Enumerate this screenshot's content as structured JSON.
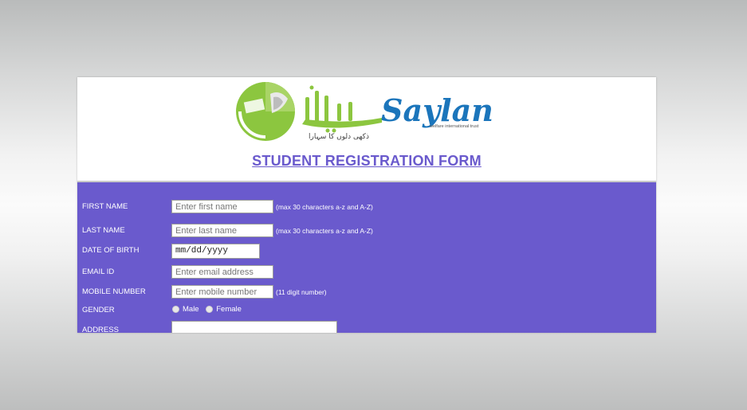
{
  "header": {
    "logo_text_urdu": "سیلانی",
    "logo_text_english": "Saylani",
    "logo_tagline": "welfare international trust",
    "logo_urdu_slogan": "ذکھی دلوں کا سہارا",
    "form_title": "STUDENT REGISTRATION FORM"
  },
  "form": {
    "first_name": {
      "label": "FIRST NAME",
      "placeholder": "Enter first name",
      "hint": "(max 30 characters a-z and A-Z)"
    },
    "last_name": {
      "label": "LAST NAME",
      "placeholder": "Enter last name",
      "hint": "(max 30 characters a-z and A-Z)"
    },
    "dob": {
      "label": "DATE OF BIRTH",
      "value": "mm/dd/yyyy"
    },
    "email": {
      "label": "EMAIL ID",
      "placeholder": "Enter email address"
    },
    "mobile": {
      "label": "MOBILE NUMBER",
      "placeholder": "Enter mobile number",
      "hint": "(11 digit number)"
    },
    "gender": {
      "label": "GENDER",
      "options": [
        "Male",
        "Female"
      ]
    },
    "address": {
      "label": "ADDRESS"
    }
  },
  "colors": {
    "form_background": "#6a5acd",
    "title_color": "#6a5acd",
    "logo_green": "#8cc63f",
    "logo_blue": "#1b75bb"
  }
}
